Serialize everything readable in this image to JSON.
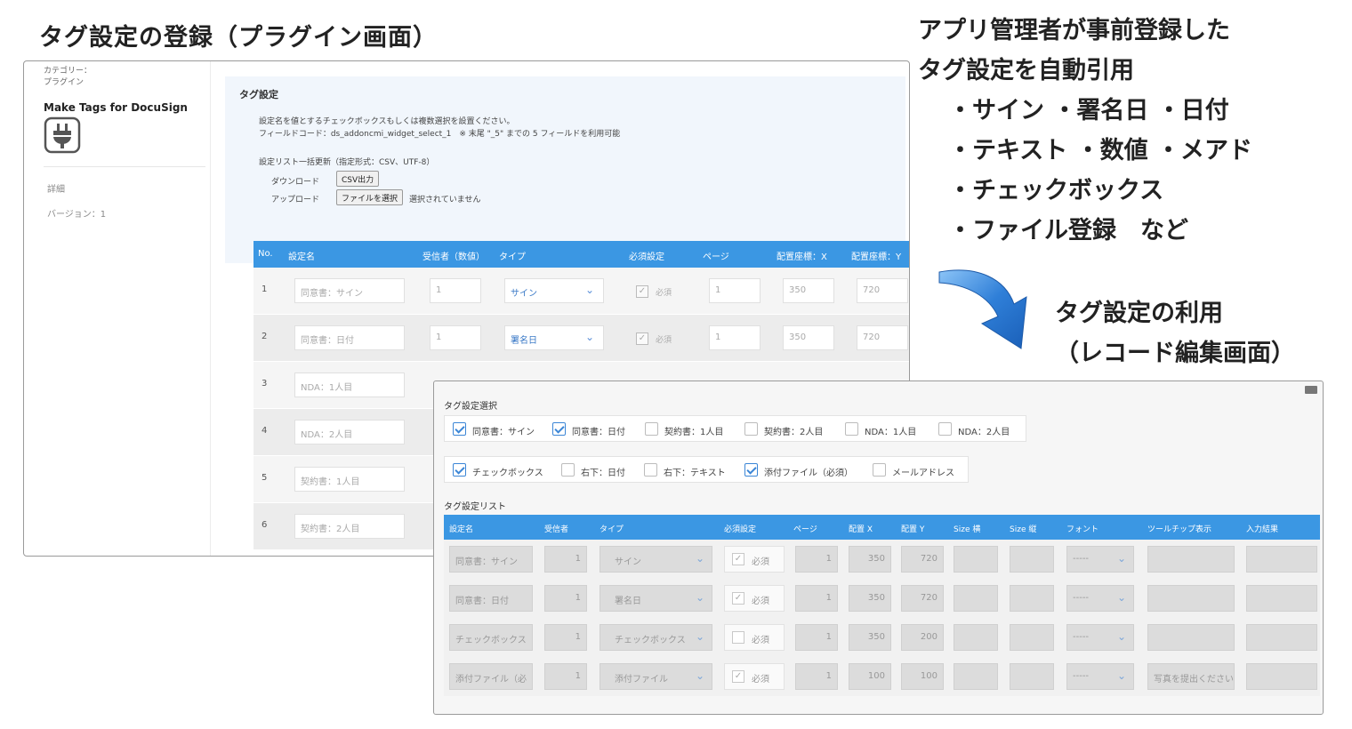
{
  "slide": {
    "title": "タグ設定の登録（プラグイン画面）",
    "description": [
      "アプリ管理者が事前登録した",
      "タグ設定を自動引用",
      "・サイン ・署名日 ・日付",
      "・テキスト ・数値 ・メアド",
      "・チェックボックス",
      "・ファイル登録　など"
    ],
    "usage_title": [
      "タグ設定の利用",
      "（レコード編集画面）"
    ]
  },
  "plugin": {
    "category_label": "カテゴリー：",
    "category_value": "プラグイン",
    "name": "Make Tags for DocuSign",
    "icon": "plug-icon",
    "detail_label": "詳細",
    "version": "バージョン：1",
    "section_title": "タグ設定",
    "instruction": "設定名を値とするチェックボックスもしくは複数選択を設置ください。",
    "field_code": "フィールドコード：ds_addoncmi_widget_select_1　※ 末尾 \"_5\" までの 5 フィールドを利用可能",
    "bulk_update": "設定リスト一括更新（指定形式：CSV、UTF-8）",
    "download_label": "ダウンロード",
    "csv_button": "CSV出力",
    "upload_label": "アップロード",
    "file_button": "ファイルを選択",
    "file_status": "選択されていません",
    "columns": [
      "No.",
      "設定名",
      "受信者（数値）",
      "タイプ",
      "必須設定",
      "ページ",
      "配置座標：X",
      "配置座標：Y"
    ],
    "rows": [
      {
        "no": "1",
        "name": "同意書：サイン",
        "recipient": "1",
        "type": "サイン",
        "required": "必須",
        "page": "1",
        "x": "350",
        "y": "720"
      },
      {
        "no": "2",
        "name": "同意書：日付",
        "recipient": "1",
        "type": "署名日",
        "required": "必須",
        "page": "1",
        "x": "350",
        "y": "720"
      },
      {
        "no": "3",
        "name": "NDA：1人目"
      },
      {
        "no": "4",
        "name": "NDA：2人目"
      },
      {
        "no": "5",
        "name": "契約書：1人目"
      },
      {
        "no": "6",
        "name": "契約書：2人目"
      }
    ]
  },
  "record": {
    "select_title": "タグ設定選択",
    "group1": [
      {
        "label": "同意書：サイン",
        "checked": true
      },
      {
        "label": "同意書：日付",
        "checked": true
      },
      {
        "label": "契約書：1人目",
        "checked": false
      },
      {
        "label": "契約書：2人目",
        "checked": false
      },
      {
        "label": "NDA：1人目",
        "checked": false
      },
      {
        "label": "NDA：2人目",
        "checked": false
      }
    ],
    "group2": [
      {
        "label": "チェックボックス",
        "checked": true
      },
      {
        "label": "右下：日付",
        "checked": false
      },
      {
        "label": "右下：テキスト",
        "checked": false
      },
      {
        "label": "添付ファイル（必須）",
        "checked": true
      },
      {
        "label": "メールアドレス",
        "checked": false
      }
    ],
    "list_title": "タグ設定リスト",
    "columns": [
      "設定名",
      "受信者",
      "タイプ",
      "必須設定",
      "ページ",
      "配置 X",
      "配置 Y",
      "Size 横",
      "Size 縦",
      "フォント",
      "ツールチップ表示",
      "入力結果"
    ],
    "rows": [
      {
        "name": "同意書：サイン",
        "recipient": "1",
        "type": "サイン",
        "required": "必須",
        "required_checked": true,
        "page": "1",
        "x": "350",
        "y": "720",
        "font": "-----",
        "tooltip": ""
      },
      {
        "name": "同意書：日付",
        "recipient": "1",
        "type": "署名日",
        "required": "必須",
        "required_checked": true,
        "page": "1",
        "x": "350",
        "y": "720",
        "font": "-----",
        "tooltip": ""
      },
      {
        "name": "チェックボックス",
        "recipient": "1",
        "type": "チェックボックス",
        "required": "必須",
        "required_checked": false,
        "page": "1",
        "x": "350",
        "y": "200",
        "font": "-----",
        "tooltip": ""
      },
      {
        "name": "添付ファイル（必",
        "recipient": "1",
        "type": "添付ファイル",
        "required": "必須",
        "required_checked": true,
        "page": "1",
        "x": "100",
        "y": "100",
        "font": "-----",
        "tooltip": "写真を提出ください"
      }
    ]
  },
  "colors": {
    "header_blue": "#3b97e3",
    "arrow_blue": "#2f7fd8",
    "check_blue": "#3b86d6"
  }
}
